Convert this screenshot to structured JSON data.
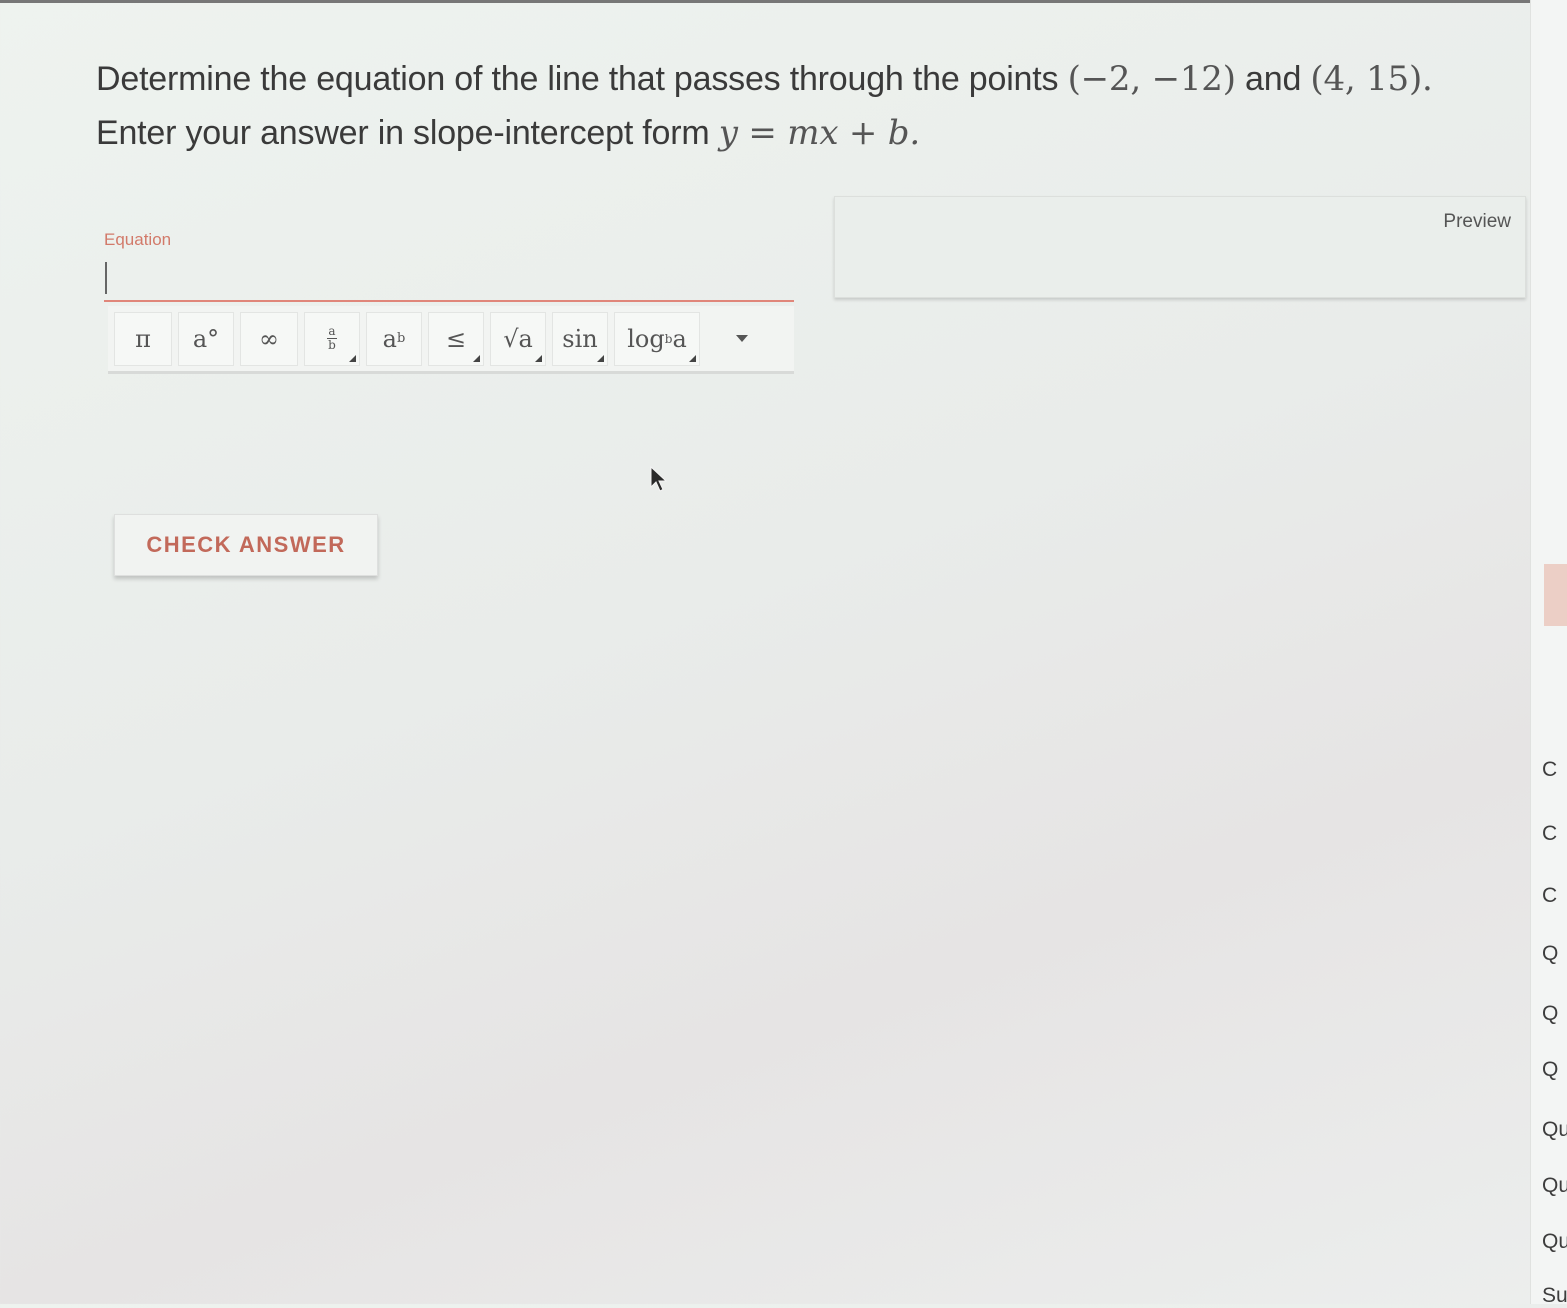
{
  "question": {
    "line1_prefix": "Determine the equation of the line that passes through the points ",
    "point1": "(−2, −12)",
    "and_text": " and ",
    "point2": "(4, 15).",
    "line2_prefix": "Enter your answer in slope-intercept form ",
    "form": "y = mx + b."
  },
  "equation": {
    "label": "Equation",
    "value": ""
  },
  "preview": {
    "label": "Preview"
  },
  "toolbar": {
    "buttons": [
      {
        "name": "pi",
        "label": "π"
      },
      {
        "name": "degree",
        "label": "a°"
      },
      {
        "name": "infinity",
        "label": "∞"
      },
      {
        "name": "fraction",
        "label_num": "a",
        "label_den": "b"
      },
      {
        "name": "power",
        "label_base": "a",
        "label_exp": "b"
      },
      {
        "name": "less-equal",
        "label": "≤"
      },
      {
        "name": "sqrt",
        "label": "√a"
      },
      {
        "name": "sin",
        "label": "sin"
      },
      {
        "name": "log",
        "label_fn": "log",
        "label_sub": "b",
        "label_arg": " a"
      }
    ]
  },
  "check_answer": {
    "label": "CHECK ANSWER"
  },
  "side_panel": {
    "items": [
      "C",
      "C",
      "C",
      "Q",
      "Q",
      "Q",
      "Qu",
      "Qu",
      "Qu",
      "Su"
    ]
  },
  "colors": {
    "accent": "#c2695a",
    "label": "#d27a6a",
    "underline": "#e0867a"
  }
}
